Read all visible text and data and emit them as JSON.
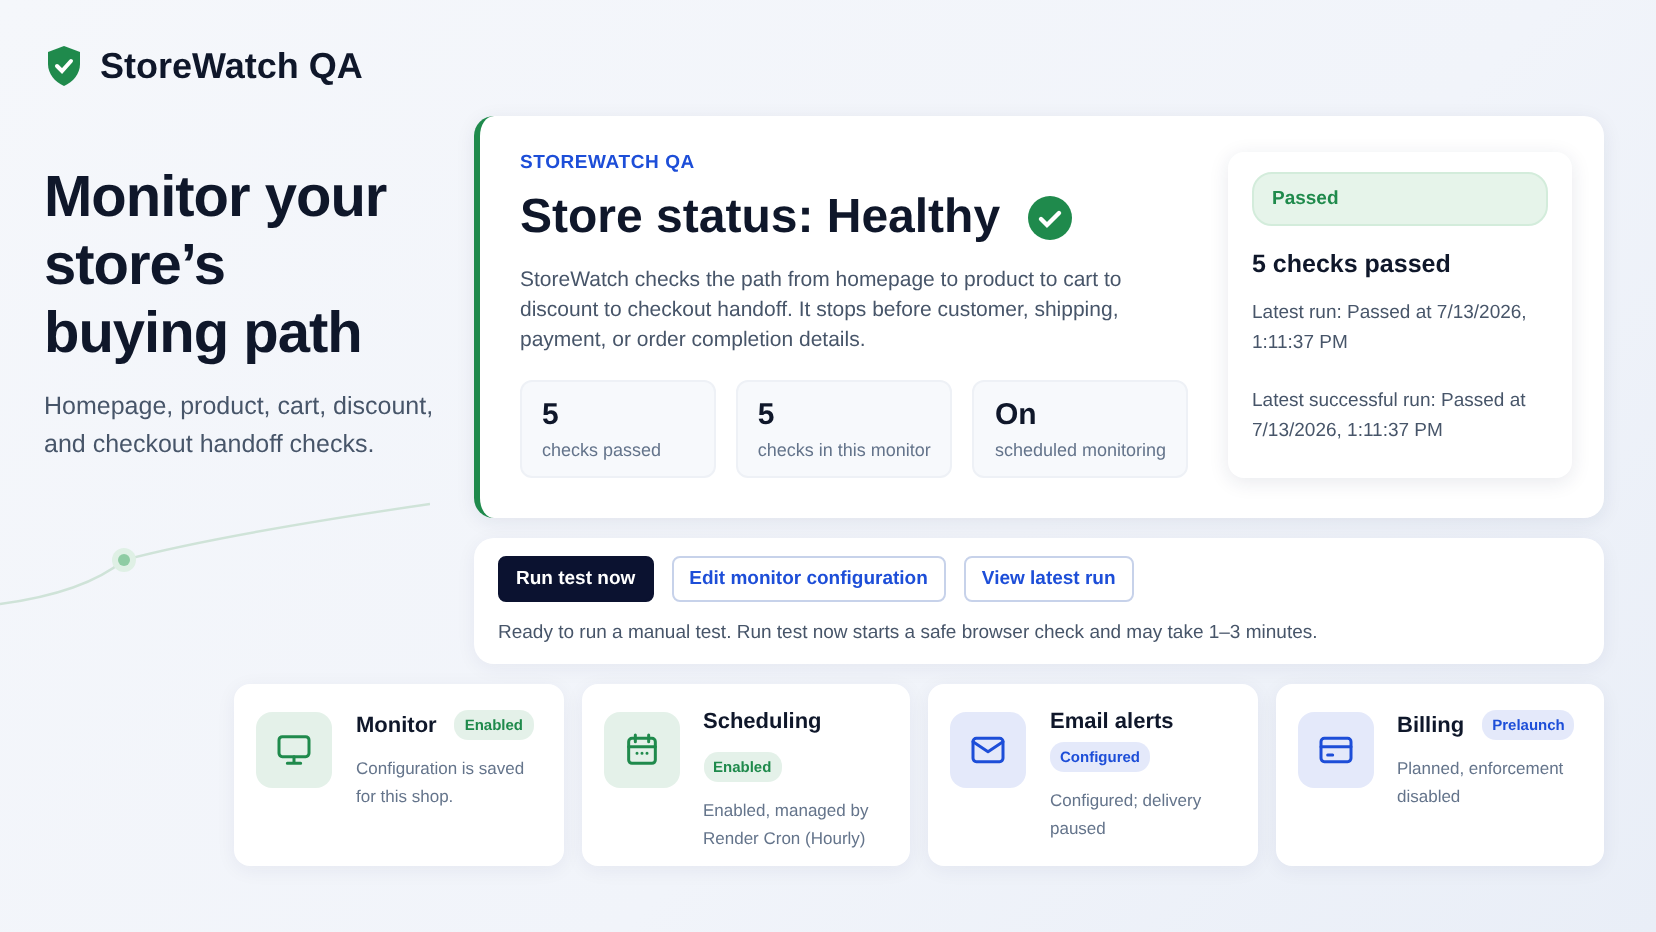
{
  "brand": {
    "name": "StoreWatch QA"
  },
  "hero": {
    "heading": "Monitor your store’s buying path",
    "subtitle": "Homepage, product, cart, discount, and checkout handoff checks."
  },
  "status_card": {
    "eyebrow": "STOREWATCH QA",
    "title": "Store status: Healthy",
    "healthy": true,
    "description": "StoreWatch checks the path from homepage to product to cart to discount to checkout handoff. It stops before customer, shipping, payment, or order completion details.",
    "stats": [
      {
        "value": "5",
        "label": "checks passed"
      },
      {
        "value": "5",
        "label": "checks in this monitor"
      },
      {
        "value": "On",
        "label": "scheduled monitoring"
      }
    ],
    "summary": {
      "badge": "Passed",
      "headline": "5 checks passed",
      "latest_run": "Latest run: Passed at 7/13/2026, 1:11:37 PM",
      "latest_success": "Latest successful run: Passed at 7/13/2026, 1:11:37 PM"
    }
  },
  "actions": {
    "buttons": [
      {
        "label": "Run test now",
        "kind": "primary"
      },
      {
        "label": "Edit monitor configuration",
        "kind": "secondary"
      },
      {
        "label": "View latest run",
        "kind": "secondary"
      }
    ],
    "note": "Ready to run a manual test. Run test now starts a safe browser check and may take 1–3 minutes."
  },
  "features": [
    {
      "kind": "monitor",
      "title": "Monitor",
      "badge": "Enabled",
      "color": "#1f8a4c",
      "description": "Configuration is saved for this shop."
    },
    {
      "kind": "calendar",
      "title": "Scheduling",
      "badge": "Enabled",
      "color": "#1f8a4c",
      "description": "Enabled, managed by Render Cron (Hourly)"
    },
    {
      "kind": "mail",
      "title": "Email alerts",
      "badge": "Configured",
      "color": "#1d4ed8",
      "description": "Configured; delivery paused"
    },
    {
      "kind": "card",
      "title": "Billing",
      "badge": "Prelaunch",
      "color": "#1d4ed8",
      "description": "Planned, enforcement disabled"
    }
  ]
}
